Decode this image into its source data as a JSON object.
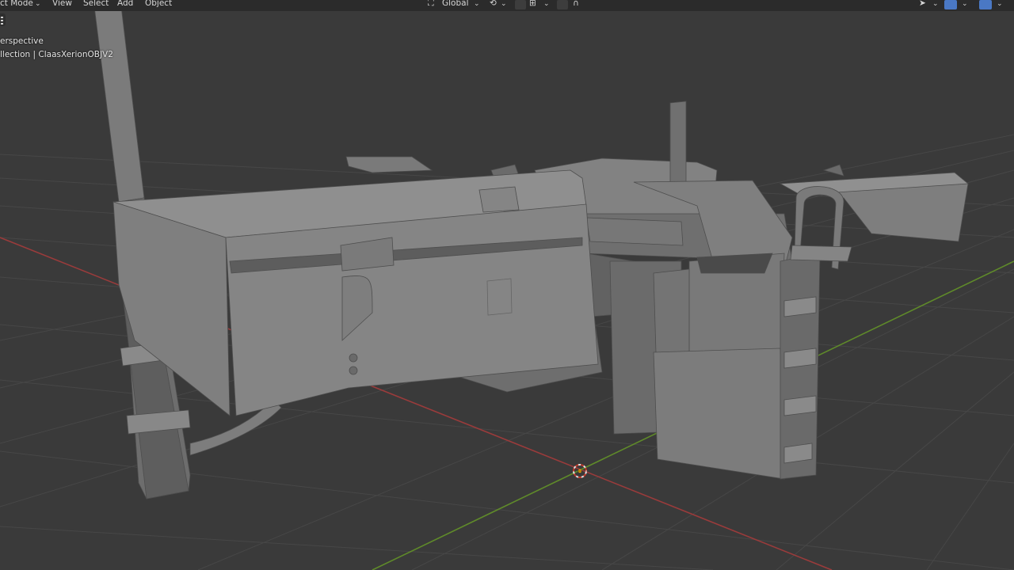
{
  "header": {
    "mode_label": "ct Mode",
    "menus": [
      "View",
      "Select",
      "Add",
      "Object"
    ],
    "orientation_label": "Global",
    "icons": [
      "transform-orientation-icon",
      "pivot-icon",
      "snap-icon",
      "snap-grid-icon",
      "proportional-edit-icon",
      "falloff-icon",
      "selectability-icon",
      "gizmo-icon",
      "overlay-icon"
    ]
  },
  "hud": {
    "view_label": "erspective",
    "collection_path": "llection | ClaasXerionOBJV2"
  },
  "colors": {
    "viewport_bg": "#3a3a3a",
    "grid": "#464646",
    "x_axis": "#9a3b3b",
    "y_axis": "#5f8a2a",
    "model_light": "#8b8b8b",
    "model_mid": "#767676",
    "model_dark": "#5c5c5c",
    "header_bg": "#2b2b2b",
    "accent_blue": "#4a78c4"
  },
  "scene": {
    "object_name": "ClaasXerionOBJV2",
    "shading": "solid"
  }
}
